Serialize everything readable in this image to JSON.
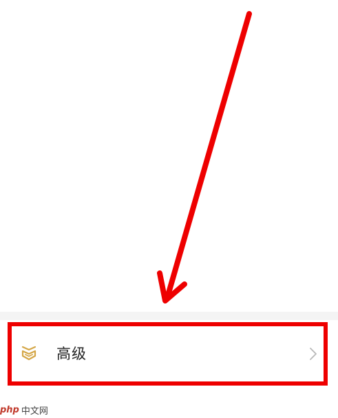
{
  "settings_row": {
    "label": "高级",
    "icon": "chevron-stack-icon",
    "icon_color": "#d4a646",
    "chevron": "chevron-right-icon",
    "chevron_color": "#b8b8b8"
  },
  "annotation": {
    "highlight_color": "#ee0000",
    "arrow_color": "#ee0000"
  },
  "watermark": {
    "brand": "php",
    "site": "中文网"
  }
}
